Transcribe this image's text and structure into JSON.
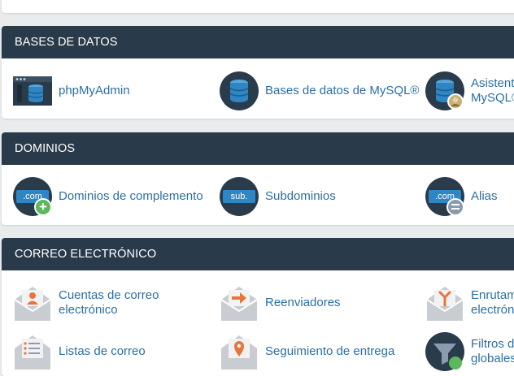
{
  "sections": {
    "databases": {
      "title": "BASES DE DATOS",
      "items": [
        {
          "label": "phpMyAdmin",
          "icon": "phpmyadmin-icon"
        },
        {
          "label": "Bases de datos de MySQL®",
          "icon": "mysql-database-icon"
        },
        {
          "label": "Asistente de bases de datos de MySQL®",
          "label_line1": "Asistente de",
          "label_line2": "MySQL®",
          "icon": "mysql-wizard-icon"
        }
      ]
    },
    "domains": {
      "title": "DOMINIOS",
      "items": [
        {
          "label": "Dominios de complemento",
          "icon": "addon-domain-icon",
          "badge_text": ".com"
        },
        {
          "label": "Subdominios",
          "icon": "subdomain-icon",
          "badge_text": "sub."
        },
        {
          "label": "Alias",
          "icon": "alias-icon",
          "badge_text": ".com"
        }
      ]
    },
    "email": {
      "title": "CORREO ELECTRÓNICO",
      "items": [
        {
          "label_line1": "Cuentas de correo",
          "label_line2": "electrónico",
          "icon": "email-accounts-icon"
        },
        {
          "label": "Reenviadores",
          "icon": "forwarders-icon"
        },
        {
          "label_line1": "Enrutamiento de correo",
          "label_line2": "electrónico",
          "icon": "email-routing-icon"
        },
        {
          "label": "Listas de correo",
          "icon": "mailing-lists-icon"
        },
        {
          "label": "Seguimiento de entrega",
          "icon": "track-delivery-icon"
        },
        {
          "label_line1": "Filtros de correo",
          "label_line2": "globales",
          "icon": "global-filters-icon"
        }
      ]
    }
  },
  "colors": {
    "header_bg": "#293a4a",
    "link": "#2a6fa5",
    "page_bg": "#e9ebed",
    "accent_orange": "#e8743b",
    "accent_green": "#5cb85c"
  }
}
